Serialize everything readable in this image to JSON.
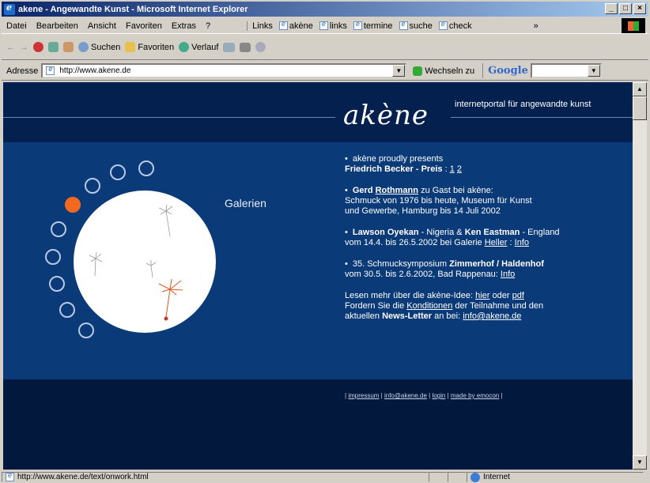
{
  "window": {
    "title": "akene - Angewandte Kunst - Microsoft Internet Explorer",
    "min": "_",
    "max": "□",
    "close": "×"
  },
  "menu": [
    "Datei",
    "Bearbeiten",
    "Ansicht",
    "Favoriten",
    "Extras",
    "?"
  ],
  "links_label": "Links",
  "links": [
    "akène",
    "links",
    "termine",
    "suche",
    "check"
  ],
  "chevron": "»",
  "toolbar": {
    "back": "←",
    "forward": "→",
    "search": "Suchen",
    "favorites": "Favoriten",
    "history": "Verlauf"
  },
  "address": {
    "label": "Adresse",
    "value": "http://www.akene.de",
    "go": "Wechseln zu"
  },
  "google": {
    "label": "Google"
  },
  "site": {
    "logo": "akène",
    "tagline": "internetportal für angewandte kunst",
    "gallery_label": "Galerien",
    "news": [
      {
        "l1": "akène proudly presents",
        "bold": "Friedrich Becker - Preis",
        "sep": " : ",
        "links": [
          "1",
          "2"
        ]
      },
      {
        "bold": "Gerd",
        "link": "Rothmann",
        "rest": "zu Gast bei akène:",
        "l2": "Schmuck von 1976 bis heute, Museum für Kunst",
        "l3": "und Gewerbe, Hamburg bis 14 Juli 2002"
      },
      {
        "bold1": "Lawson Oyekan",
        "mid": " - Nigeria & ",
        "bold2": "Ken Eastman",
        "end": " - England",
        "l2": "vom 14.4. bis 26.5.2002 bei Galerie ",
        "link1": "Heller",
        "sep": " : ",
        "link2": "Info"
      },
      {
        "pre": "35. Schmucksymposium ",
        "bold": "Zimmerhof / Haldenhof",
        "l2": "vom 30.5. bis 2.6.2002, Bad Rappenau: ",
        "link": "Info"
      }
    ],
    "more": {
      "l1a": "Lesen mehr über die akène-Idee: ",
      "hier": "hier",
      "oder": " oder ",
      "pdf": "pdf",
      "l2a": "Fordern Sie die ",
      "konditionen": "Konditionen",
      "l2b": " der Teilnahme und den",
      "l3a": "aktuellen ",
      "newsletter": "News-Letter",
      "l3b": " an bei: ",
      "email": "info@akene.de"
    },
    "footer": [
      "impressum",
      "info@akene.de",
      "login",
      "made by emocon"
    ]
  },
  "statusbar": {
    "url": "http://www.akene.de/text/onwork.html",
    "zone": "Internet"
  }
}
